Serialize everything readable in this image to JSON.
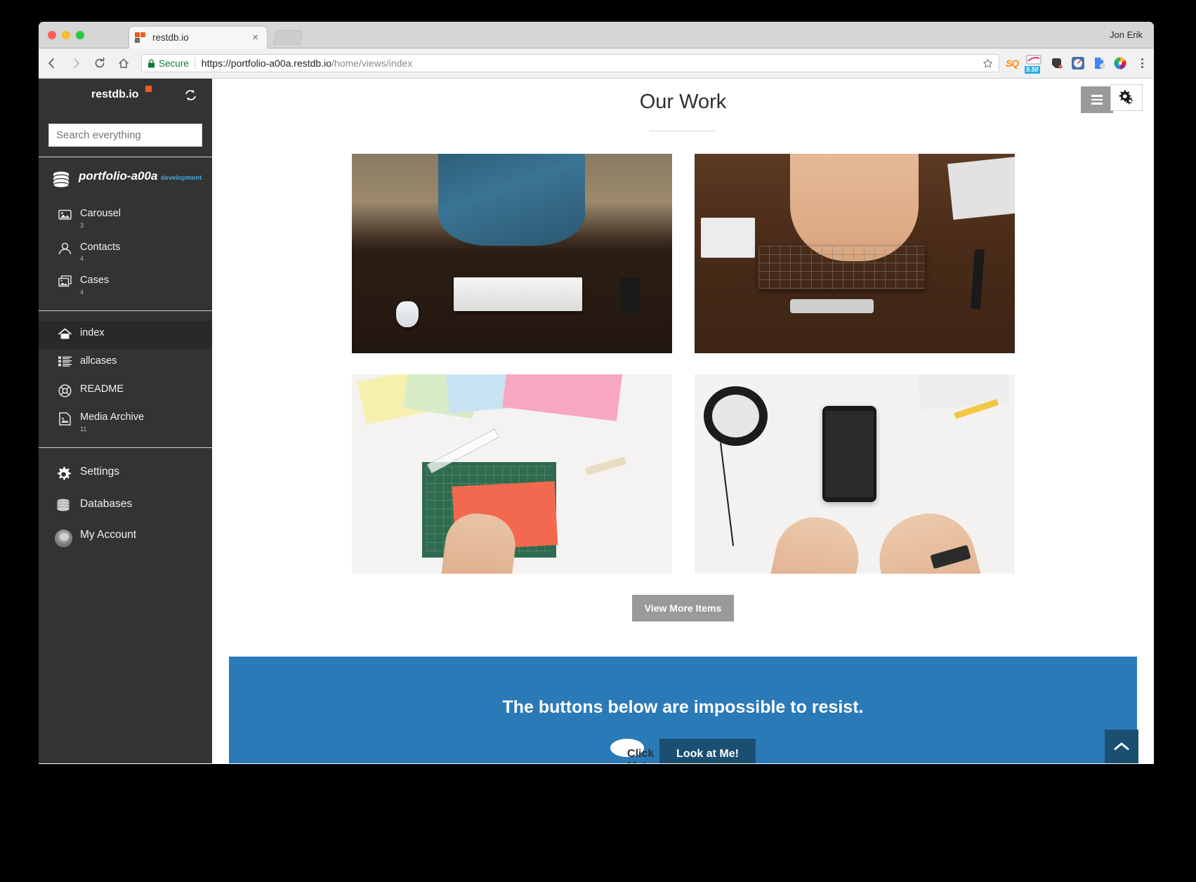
{
  "browser": {
    "tab_title": "restdb.io",
    "tab_close_glyph": "×",
    "user_name": "Jon Erik",
    "security_label": "Secure",
    "url_host": "https://portfolio-a00a.restdb.io",
    "url_path": "/home/views/index",
    "extensions": [
      {
        "name": "sq-extension-icon",
        "label": "SQ"
      },
      {
        "name": "badge-extension-icon",
        "label": "5.50"
      },
      {
        "name": "evernote-extension-icon",
        "label": ""
      },
      {
        "name": "gauge-extension-icon",
        "label": ""
      },
      {
        "name": "docs-extension-icon",
        "label": ""
      },
      {
        "name": "color-wheel-extension-icon",
        "label": ""
      }
    ]
  },
  "sidebar": {
    "brand": "restdb.io",
    "search_placeholder": "Search everything",
    "database": {
      "name": "portfolio-a00a",
      "environment": "development"
    },
    "collections": [
      {
        "label": "Carousel",
        "count": "3",
        "icon": "image-stack-icon"
      },
      {
        "label": "Contacts",
        "count": "4",
        "icon": "person-icon"
      },
      {
        "label": "Cases",
        "count": "4",
        "icon": "photo-icon"
      }
    ],
    "pages": [
      {
        "label": "index",
        "count": "",
        "icon": "home-icon",
        "active": true
      },
      {
        "label": "allcases",
        "count": "",
        "icon": "list-icon",
        "active": false
      },
      {
        "label": "README",
        "count": "",
        "icon": "lifebuoy-icon",
        "active": false
      },
      {
        "label": "Media Archive",
        "count": "11",
        "icon": "media-icon",
        "active": false
      }
    ],
    "footer": [
      {
        "label": "Settings",
        "icon": "gear-icon"
      },
      {
        "label": "Databases",
        "icon": "database-icon"
      },
      {
        "label": "My Account",
        "icon": "avatar-icon"
      }
    ]
  },
  "main": {
    "title": "Our Work",
    "gallery": [
      {
        "alt": "man standing at desk with keyboard and mouse"
      },
      {
        "alt": "hands typing on a keyboard on a dark wooden desk"
      },
      {
        "alt": "colored paper, cutting mat and ruler on a white desk"
      },
      {
        "alt": "hands holding a smartphone next to headphones"
      }
    ],
    "view_more_label": "View More Items",
    "callout": {
      "heading": "The buttons below are impossible to resist.",
      "primary_label": "Click Me!",
      "secondary_label": "Look at Me!",
      "background_color": "#2b7ab8",
      "secondary_color": "#1b4f72"
    },
    "scroll_top_label": "⌃"
  }
}
